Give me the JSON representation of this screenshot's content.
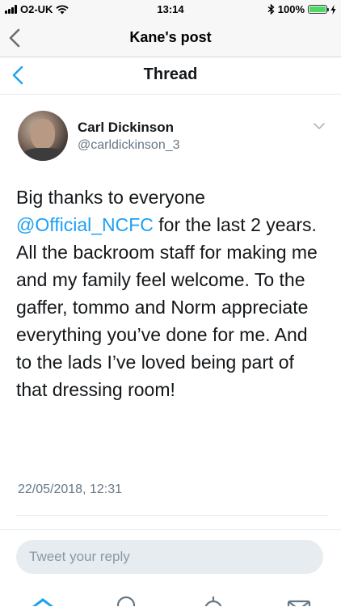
{
  "status_bar": {
    "carrier": "O2-UK",
    "time": "13:14",
    "battery": "100%",
    "battery_level": 1.0
  },
  "outer_nav": {
    "title": "Kane's post",
    "back_icon": "chevron-left-icon"
  },
  "thread_nav": {
    "title": "Thread",
    "back_icon": "chevron-left-icon"
  },
  "tweet": {
    "display_name": "Carl Dickinson",
    "handle": "@carldickinson_3",
    "text_before_mention": "Big thanks to everyone ",
    "mention": "@Official_NCFC",
    "text_after_mention": " for the last 2 years. All the backroom staff for making me and my family feel welcome. To the gaffer, tommo and Norm appreciate everything you’ve done for me. And to the lads I’ve loved being part of that dressing room!",
    "timestamp": "22/05/2018, 12:31"
  },
  "reply": {
    "placeholder": "Tweet your reply"
  },
  "tab_bar": {
    "items": [
      "home-icon",
      "search-icon",
      "notifications-icon",
      "messages-icon"
    ]
  },
  "colors": {
    "accent": "#1da1f2",
    "text": "#14171a",
    "secondary": "#657786",
    "battery": "#4cd964"
  }
}
